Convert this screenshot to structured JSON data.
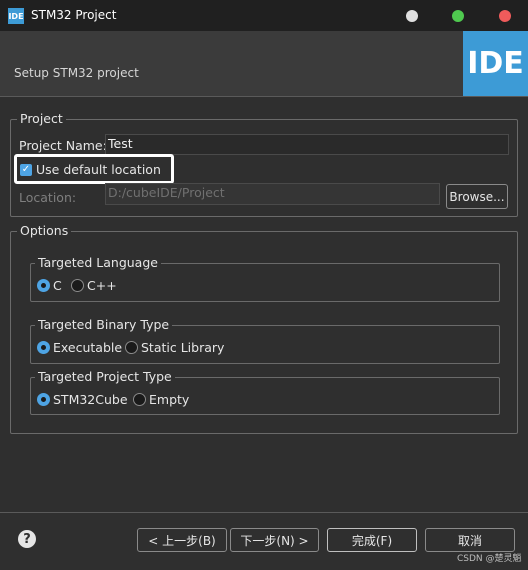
{
  "window": {
    "icon": "IDE",
    "title": "STM32 Project"
  },
  "header": {
    "subtitle": "Setup STM32 project",
    "logo": "IDE"
  },
  "project_group": {
    "legend": "Project",
    "name_label": "Project Name:",
    "name_value": "Test",
    "use_default_location_label": "Use default location",
    "use_default_location_checked": true,
    "location_label": "Location:",
    "location_value": "D:/cubeIDE/Project",
    "browse_label": "Browse..."
  },
  "options_group": {
    "legend": "Options",
    "targeted_language": {
      "legend": "Targeted Language",
      "options": [
        "C",
        "C++"
      ],
      "selected": "C"
    },
    "targeted_binary_type": {
      "legend": "Targeted Binary Type",
      "options": [
        "Executable",
        "Static Library"
      ],
      "selected": "Executable"
    },
    "targeted_project_type": {
      "legend": "Targeted Project Type",
      "options": [
        "STM32Cube",
        "Empty"
      ],
      "selected": "STM32Cube"
    }
  },
  "footer": {
    "back_label": "< 上一步(B)",
    "next_label": "下一步(N) >",
    "finish_label": "完成(F)",
    "cancel_label": "取消",
    "watermark": "CSDN @楚灵魈"
  },
  "colors": {
    "accent": "#3d9bd6",
    "selection": "#4ea4e4",
    "background": "#2f2f2f"
  },
  "icons": {
    "help": "help-icon",
    "app": "ide-app-icon"
  }
}
